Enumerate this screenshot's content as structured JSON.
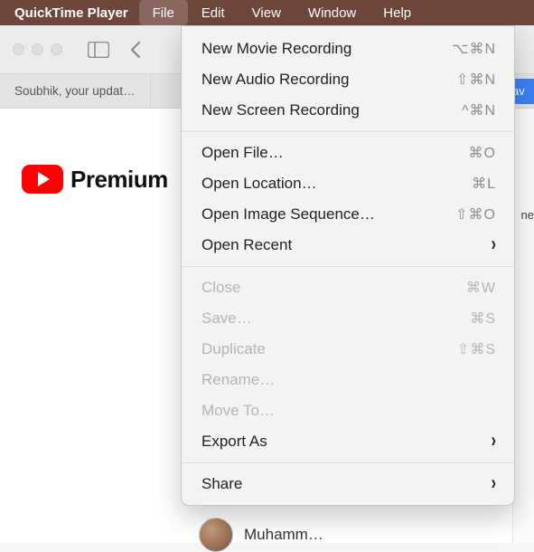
{
  "menubar": {
    "app_name": "QuickTime Player",
    "items": [
      {
        "label": "File",
        "active": true
      },
      {
        "label": "Edit",
        "active": false
      },
      {
        "label": "View",
        "active": false
      },
      {
        "label": "Window",
        "active": false
      },
      {
        "label": "Help",
        "active": false
      }
    ]
  },
  "toolbar": {
    "traffic_state": "inactive"
  },
  "tabs": {
    "first_visible": "Soubhik, your updat…",
    "right_fragment": "av"
  },
  "page": {
    "premium_text": "Premium",
    "sidebar_fragment": "ne",
    "chat_name_fragment": "Muhamm…"
  },
  "file_menu": {
    "groups": [
      [
        {
          "label": "New Movie Recording",
          "shortcut": "⌥⌘N",
          "enabled": true,
          "submenu": false
        },
        {
          "label": "New Audio Recording",
          "shortcut": "⇧⌘N",
          "enabled": true,
          "submenu": false
        },
        {
          "label": "New Screen Recording",
          "shortcut": "^⌘N",
          "enabled": true,
          "submenu": false
        }
      ],
      [
        {
          "label": "Open File…",
          "shortcut": "⌘O",
          "enabled": true,
          "submenu": false
        },
        {
          "label": "Open Location…",
          "shortcut": "⌘L",
          "enabled": true,
          "submenu": false
        },
        {
          "label": "Open Image Sequence…",
          "shortcut": "⇧⌘O",
          "enabled": true,
          "submenu": false
        },
        {
          "label": "Open Recent",
          "shortcut": "",
          "enabled": true,
          "submenu": true
        }
      ],
      [
        {
          "label": "Close",
          "shortcut": "⌘W",
          "enabled": false,
          "submenu": false
        },
        {
          "label": "Save…",
          "shortcut": "⌘S",
          "enabled": false,
          "submenu": false
        },
        {
          "label": "Duplicate",
          "shortcut": "⇧⌘S",
          "enabled": false,
          "submenu": false
        },
        {
          "label": "Rename…",
          "shortcut": "",
          "enabled": false,
          "submenu": false
        },
        {
          "label": "Move To…",
          "shortcut": "",
          "enabled": false,
          "submenu": false
        },
        {
          "label": "Export As",
          "shortcut": "",
          "enabled": true,
          "submenu": true
        }
      ],
      [
        {
          "label": "Share",
          "shortcut": "",
          "enabled": true,
          "submenu": true
        }
      ]
    ]
  }
}
